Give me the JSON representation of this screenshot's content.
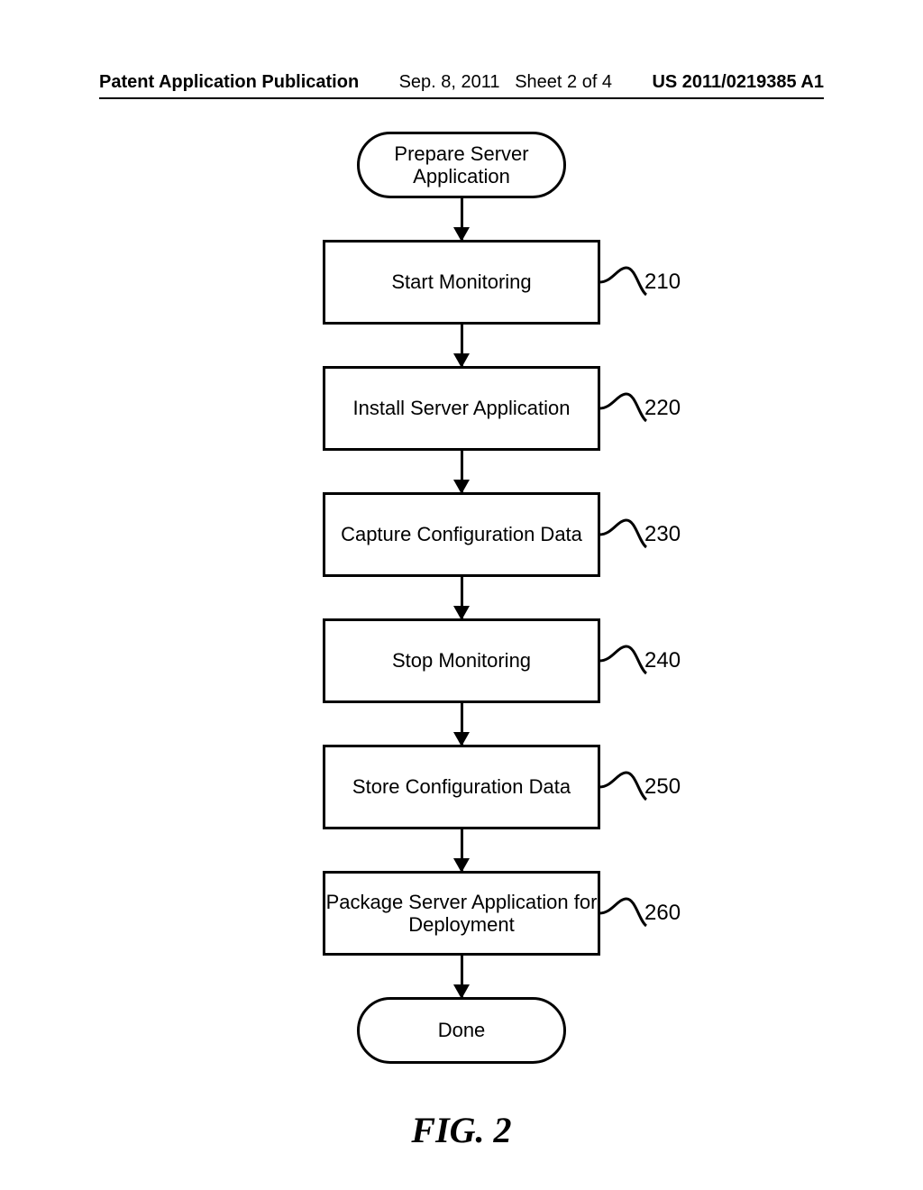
{
  "header": {
    "publication_label": "Patent Application Publication",
    "date": "Sep. 8, 2011",
    "sheet": "Sheet 2 of 4",
    "pub_number": "US 2011/0219385 A1"
  },
  "flowchart": {
    "start": "Prepare Server\nApplication",
    "end": "Done",
    "steps": [
      {
        "label": "Start Monitoring",
        "ref": "210"
      },
      {
        "label": "Install Server Application",
        "ref": "220"
      },
      {
        "label": "Capture Configuration Data",
        "ref": "230"
      },
      {
        "label": "Stop Monitoring",
        "ref": "240"
      },
      {
        "label": "Store Configuration Data",
        "ref": "250"
      },
      {
        "label": "Package Server Application for\nDeployment",
        "ref": "260"
      }
    ]
  },
  "figure_caption": "FIG. 2",
  "chart_data": {
    "type": "flowchart",
    "title": "FIG. 2",
    "nodes": [
      {
        "id": "start",
        "type": "terminator",
        "label": "Prepare Server Application"
      },
      {
        "id": "210",
        "type": "process",
        "label": "Start Monitoring",
        "ref": "210"
      },
      {
        "id": "220",
        "type": "process",
        "label": "Install Server Application",
        "ref": "220"
      },
      {
        "id": "230",
        "type": "process",
        "label": "Capture Configuration Data",
        "ref": "230"
      },
      {
        "id": "240",
        "type": "process",
        "label": "Stop Monitoring",
        "ref": "240"
      },
      {
        "id": "250",
        "type": "process",
        "label": "Store Configuration Data",
        "ref": "250"
      },
      {
        "id": "260",
        "type": "process",
        "label": "Package Server Application for Deployment",
        "ref": "260"
      },
      {
        "id": "done",
        "type": "terminator",
        "label": "Done"
      }
    ],
    "edges": [
      {
        "from": "start",
        "to": "210"
      },
      {
        "from": "210",
        "to": "220"
      },
      {
        "from": "220",
        "to": "230"
      },
      {
        "from": "230",
        "to": "240"
      },
      {
        "from": "240",
        "to": "250"
      },
      {
        "from": "250",
        "to": "260"
      },
      {
        "from": "260",
        "to": "done"
      }
    ]
  }
}
